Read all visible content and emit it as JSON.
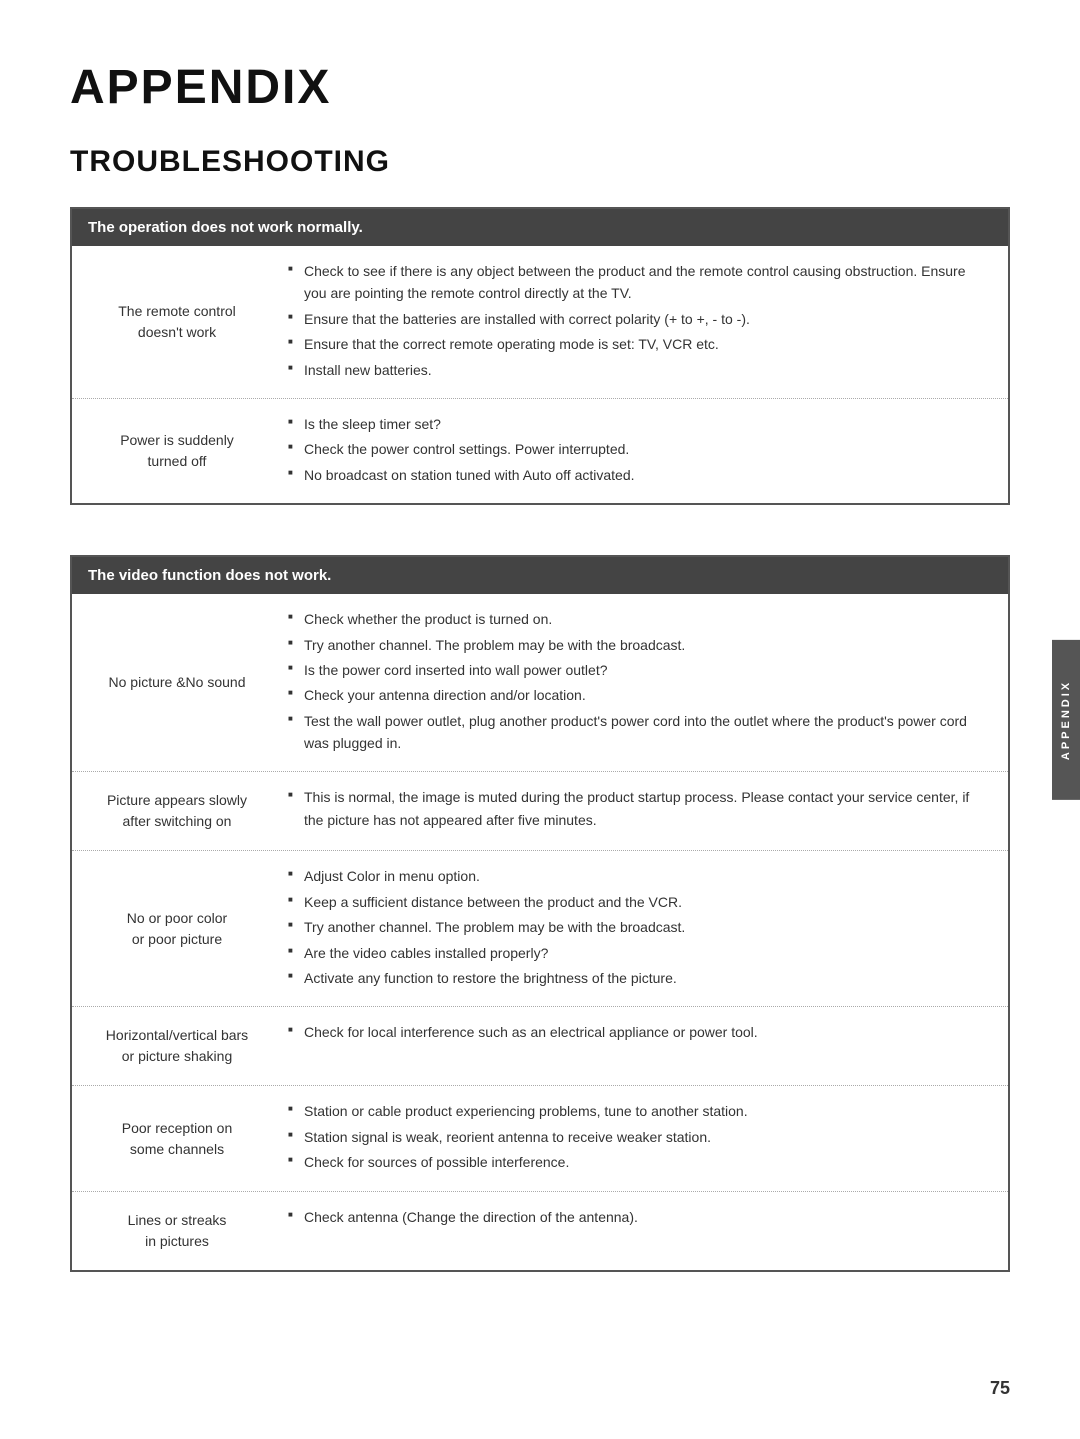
{
  "page": {
    "title": "APPENDIX",
    "section": "TROUBLESHOOTING",
    "page_number": "75",
    "sidebar_label": "APPENDIX"
  },
  "table1": {
    "header": "The operation does not work normally.",
    "rows": [
      {
        "label": "The remote control\ndoesn't work",
        "items": [
          "Check to see if there is any object between the product and the remote control causing obstruction. Ensure you are pointing the remote control directly at the TV.",
          "Ensure that the batteries are installed with correct polarity (+ to +, - to -).",
          "Ensure that the correct remote operating mode is set: TV, VCR etc.",
          "Install new batteries."
        ]
      },
      {
        "label": "Power is suddenly\nturned off",
        "items": [
          "Is the sleep timer set?",
          "Check the power control settings. Power interrupted.",
          "No broadcast on station tuned with Auto off activated."
        ]
      }
    ]
  },
  "table2": {
    "header": "The video function does not work.",
    "rows": [
      {
        "label": "No picture &No sound",
        "items": [
          "Check whether the product is turned on.",
          "Try another channel. The problem may be with the broadcast.",
          "Is the power cord inserted into wall power outlet?",
          "Check your antenna direction and/or location.",
          "Test the wall power outlet, plug another product's power cord into the outlet where the product's power cord was plugged in."
        ]
      },
      {
        "label": "Picture appears slowly\nafter switching on",
        "items": [
          "This is normal, the image is muted during the product startup process. Please contact your service center, if the picture has not appeared after five minutes."
        ]
      },
      {
        "label": "No or poor color\nor poor picture",
        "items": [
          "Adjust Color in menu option.",
          "Keep a sufficient distance between the product and the VCR.",
          "Try another channel. The problem may be with the broadcast.",
          "Are the video cables installed properly?",
          "Activate any function to restore the brightness of the picture."
        ]
      },
      {
        "label": "Horizontal/vertical bars\nor picture shaking",
        "items": [
          "Check for local interference such as an electrical appliance or power tool."
        ]
      },
      {
        "label": "Poor reception on\nsome channels",
        "items": [
          "Station or cable product experiencing problems, tune to another station.",
          "Station signal is weak, reorient antenna to receive weaker station.",
          "Check for sources of possible interference."
        ]
      },
      {
        "label": "Lines or streaks\nin pictures",
        "items": [
          "Check antenna (Change the direction of the antenna)."
        ]
      }
    ]
  }
}
